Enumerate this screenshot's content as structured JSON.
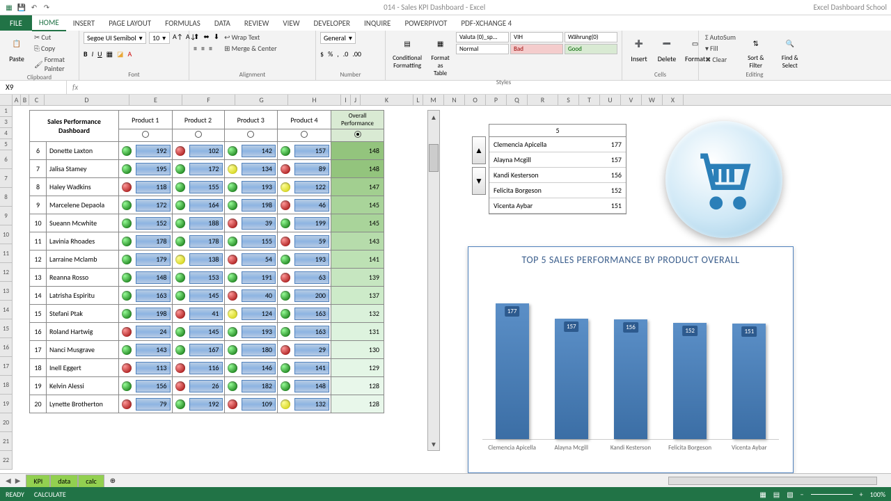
{
  "titlebar": {
    "title": "014 - Sales KPI Dashboard - Excel",
    "school": "Excel Dashboard School"
  },
  "ribbon_tabs": {
    "file": "FILE",
    "tabs": [
      "HOME",
      "INSERT",
      "PAGE LAYOUT",
      "FORMULAS",
      "DATA",
      "REVIEW",
      "VIEW",
      "DEVELOPER",
      "INQUIRE",
      "POWERPIVOT",
      "PDF-XChange 4"
    ]
  },
  "ribbon": {
    "clipboard": {
      "paste": "Paste",
      "cut": "Cut",
      "copy": "Copy",
      "painter": "Format Painter",
      "label": "Clipboard"
    },
    "font": {
      "name": "Segoe UI Semibol",
      "size": "10",
      "label": "Font"
    },
    "alignment": {
      "wrap": "Wrap Text",
      "merge": "Merge & Center",
      "label": "Alignment"
    },
    "number": {
      "format": "General",
      "label": "Number"
    },
    "styles": {
      "cond": "Conditional Formatting",
      "fmttable": "Format as Table",
      "valuta": "Valuta (0)_sp...",
      "vih": "VIH",
      "wahrung": "Währung(0)",
      "normal": "Normal",
      "bad": "Bad",
      "good": "Good",
      "label": "Styles"
    },
    "cells": {
      "insert": "Insert",
      "delete": "Delete",
      "format": "Format",
      "label": "Cells"
    },
    "editing": {
      "autosum": "AutoSum",
      "fill": "Fill",
      "clear": "Clear",
      "sort": "Sort & Filter",
      "find": "Find & Select",
      "label": "Editing"
    }
  },
  "formula_bar": {
    "cell": "X9",
    "fx": "fx"
  },
  "col_letters": [
    "A",
    "B",
    "C",
    "D",
    "E",
    "F",
    "G",
    "H",
    "I",
    "J",
    "K",
    "L",
    "M",
    "N",
    "O",
    "P",
    "Q",
    "R",
    "S",
    "T",
    "U",
    "V",
    "W",
    "X"
  ],
  "row_nums": [
    "1",
    "3",
    "4",
    "5",
    "6",
    "7",
    "8",
    "9",
    "10",
    "11",
    "12",
    "13",
    "14",
    "15",
    "16",
    "17",
    "18",
    "19",
    "20",
    "21",
    "22"
  ],
  "dashboard": {
    "title": "Sales Performance Dashboard",
    "products": [
      "Product 1",
      "Product 2",
      "Product 3",
      "Product 4"
    ],
    "overall": "Overall Performance",
    "rows": [
      {
        "idx": 6,
        "name": "Donette Laxton",
        "v": [
          [
            "g",
            192
          ],
          [
            "r",
            102
          ],
          [
            "g",
            142
          ],
          [
            "g",
            157
          ]
        ],
        "ov": 148,
        "oc": "#93c47d"
      },
      {
        "idx": 7,
        "name": "Jalisa Stamey",
        "v": [
          [
            "g",
            195
          ],
          [
            "g",
            172
          ],
          [
            "y",
            134
          ],
          [
            "r",
            89
          ]
        ],
        "ov": 148,
        "oc": "#93c47d"
      },
      {
        "idx": 8,
        "name": "Haley Wadkins",
        "v": [
          [
            "r",
            118
          ],
          [
            "g",
            155
          ],
          [
            "g",
            193
          ],
          [
            "y",
            122
          ]
        ],
        "ov": 147,
        "oc": "#a2cf90"
      },
      {
        "idx": 9,
        "name": "Marcelene Depaola",
        "v": [
          [
            "g",
            172
          ],
          [
            "g",
            164
          ],
          [
            "g",
            198
          ],
          [
            "r",
            46
          ]
        ],
        "ov": 145,
        "oc": "#a9d49a"
      },
      {
        "idx": 10,
        "name": "Sueann Mcwhite",
        "v": [
          [
            "g",
            152
          ],
          [
            "g",
            188
          ],
          [
            "r",
            39
          ],
          [
            "g",
            199
          ]
        ],
        "ov": 145,
        "oc": "#a9d49a"
      },
      {
        "idx": 11,
        "name": "Lavinia Rhoades",
        "v": [
          [
            "g",
            178
          ],
          [
            "g",
            178
          ],
          [
            "g",
            155
          ],
          [
            "r",
            59
          ]
        ],
        "ov": 143,
        "oc": "#b6dcab"
      },
      {
        "idx": 12,
        "name": "Larraine Mclamb",
        "v": [
          [
            "g",
            179
          ],
          [
            "y",
            138
          ],
          [
            "r",
            54
          ],
          [
            "g",
            193
          ]
        ],
        "ov": 141,
        "oc": "#bde1b4"
      },
      {
        "idx": 13,
        "name": "Reanna Rosso",
        "v": [
          [
            "g",
            148
          ],
          [
            "g",
            153
          ],
          [
            "g",
            191
          ],
          [
            "r",
            63
          ]
        ],
        "ov": 139,
        "oc": "#c6e6c0"
      },
      {
        "idx": 14,
        "name": "Latrisha Espiritu",
        "v": [
          [
            "g",
            163
          ],
          [
            "g",
            145
          ],
          [
            "r",
            40
          ],
          [
            "g",
            200
          ]
        ],
        "ov": 137,
        "oc": "#cdebc9"
      },
      {
        "idx": 15,
        "name": "Stefani Ptak",
        "v": [
          [
            "g",
            198
          ],
          [
            "r",
            41
          ],
          [
            "y",
            124
          ],
          [
            "g",
            163
          ]
        ],
        "ov": 132,
        "oc": "#daf1da"
      },
      {
        "idx": 16,
        "name": "Roland Hartwig",
        "v": [
          [
            "r",
            24
          ],
          [
            "g",
            145
          ],
          [
            "g",
            193
          ],
          [
            "g",
            163
          ]
        ],
        "ov": 131,
        "oc": "#ddf3de"
      },
      {
        "idx": 17,
        "name": "Nanci Musgrave",
        "v": [
          [
            "g",
            143
          ],
          [
            "g",
            167
          ],
          [
            "g",
            180
          ],
          [
            "r",
            29
          ]
        ],
        "ov": 130,
        "oc": "#e1f4e2"
      },
      {
        "idx": 18,
        "name": "Inell Eggert",
        "v": [
          [
            "r",
            113
          ],
          [
            "r",
            116
          ],
          [
            "g",
            146
          ],
          [
            "g",
            141
          ]
        ],
        "ov": 129,
        "oc": "#e4f6e6"
      },
      {
        "idx": 19,
        "name": "Kelvin Alessi",
        "v": [
          [
            "g",
            156
          ],
          [
            "r",
            26
          ],
          [
            "g",
            182
          ],
          [
            "g",
            148
          ]
        ],
        "ov": 128,
        "oc": "#e8f7ea"
      },
      {
        "idx": 20,
        "name": "Lynette Brotherton",
        "v": [
          [
            "r",
            79
          ],
          [
            "g",
            192
          ],
          [
            "r",
            109
          ],
          [
            "y",
            132
          ]
        ],
        "ov": 128,
        "oc": "#e8f7ea"
      }
    ]
  },
  "top5_hdr": "5",
  "top5": [
    {
      "name": "Clemencia Apicella",
      "v": 177
    },
    {
      "name": "Alayna Mcgill",
      "v": 157
    },
    {
      "name": "Kandi Kesterson",
      "v": 156
    },
    {
      "name": "Felicita Borgeson",
      "v": 152
    },
    {
      "name": "Vicenta Aybar",
      "v": 151
    }
  ],
  "chart_data": {
    "type": "bar",
    "title": "TOP 5 SALES PERFORMANCE BY PRODUCT OVERALL",
    "categories": [
      "Clemencia Apicella",
      "Alayna Mcgill",
      "Kandi Kesterson",
      "Felicita Borgeson",
      "Vicenta Aybar"
    ],
    "values": [
      177,
      157,
      156,
      152,
      151
    ],
    "ylim": [
      0,
      200
    ]
  },
  "sheets": {
    "s1": "KPI",
    "s2": "data",
    "s3": "calc"
  },
  "status": {
    "ready": "READY",
    "calc": "CALCULATE",
    "zoom": "100%"
  }
}
